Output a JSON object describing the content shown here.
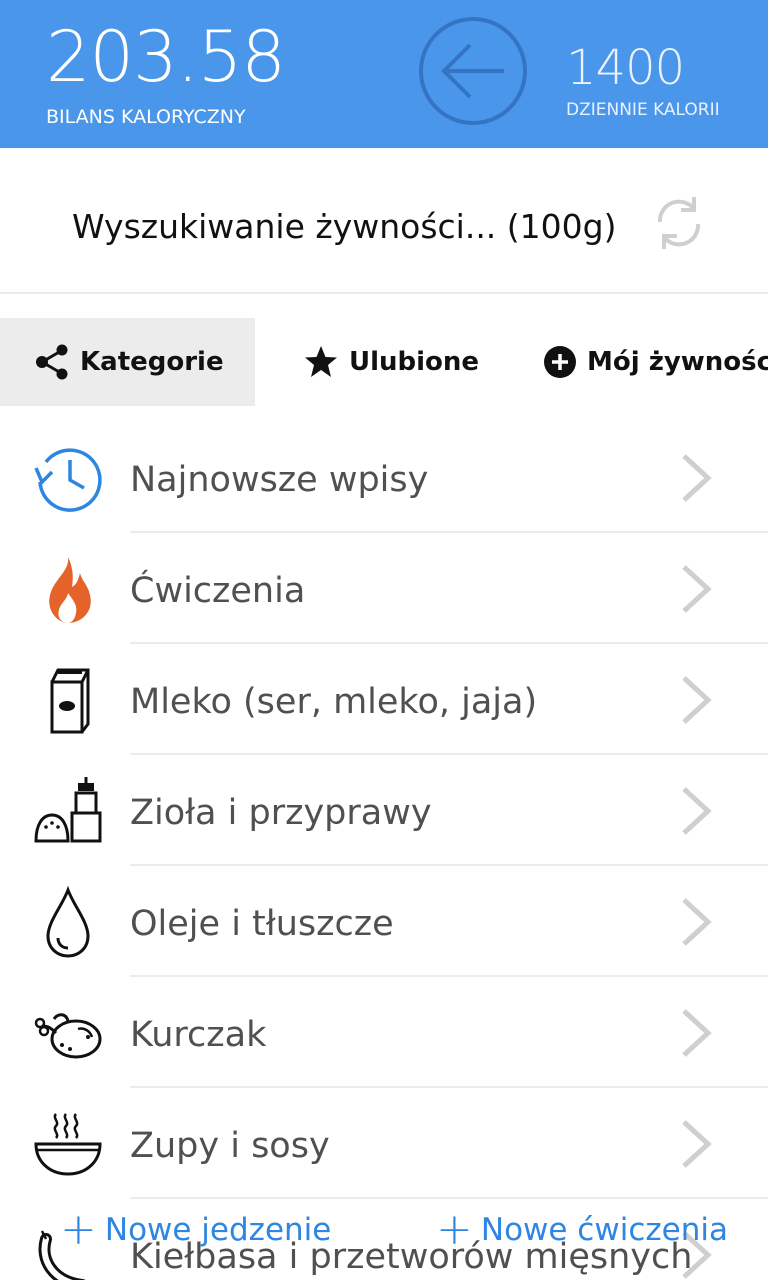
{
  "header": {
    "balance_value": "203.58",
    "balance_label": "BILANS KALORYCZNY",
    "daily_value": "1400",
    "daily_label": "DZIENNIE KALORII",
    "back_icon": "arrow-left-circle-icon",
    "bg_color": "#4a96ea"
  },
  "search": {
    "placeholder": "Wyszukiwanie żywności... (100g)",
    "refresh_icon": "refresh-icon"
  },
  "tabs": [
    {
      "label": "Kategorie",
      "icon": "share-icon",
      "active": true
    },
    {
      "label": "Ulubione",
      "icon": "star-icon",
      "active": false
    },
    {
      "label": "Mój żywności",
      "icon": "plus-circle-icon",
      "active": false
    }
  ],
  "categories": [
    {
      "label": "Najnowsze wpisy",
      "icon": "history-clock-icon"
    },
    {
      "label": "Ćwiczenia",
      "icon": "flame-icon"
    },
    {
      "label": "Mleko (ser, mleko, jaja)",
      "icon": "milk-carton-icon"
    },
    {
      "label": "Zioła i przyprawy",
      "icon": "salt-pepper-icon"
    },
    {
      "label": "Oleje i tłuszcze",
      "icon": "oil-drop-icon"
    },
    {
      "label": "Kurczak",
      "icon": "roast-chicken-icon"
    },
    {
      "label": "Zupy i sosy",
      "icon": "soup-bowl-icon"
    },
    {
      "label": "Kiełbasa i przetworów mięsnych",
      "icon": "sausage-icon"
    }
  ],
  "bottom_bar": {
    "new_food": "Nowe jedzenie",
    "new_exercise": "Nowe ćwiczenia",
    "accent_color": "#2f86e2"
  }
}
